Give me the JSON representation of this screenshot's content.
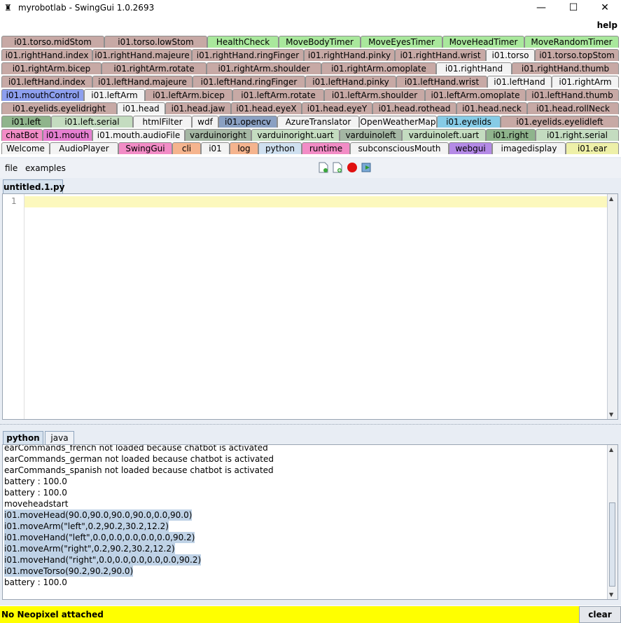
{
  "window": {
    "title": "myrobotlab - SwingGui 1.0.2693",
    "minimize": "—",
    "maximize": "☐",
    "close": "✕"
  },
  "menubar": {
    "help": "help"
  },
  "tab_rows": [
    [
      {
        "label": "i01.torso.midStom",
        "color": "#c7a9a5"
      },
      {
        "label": "i01.torso.lowStom",
        "color": "#c7a9a5"
      },
      {
        "label": "HealthCheck",
        "color": "#a9e89c"
      },
      {
        "label": "MoveBodyTimer",
        "color": "#a9e89c"
      },
      {
        "label": "MoveEyesTimer",
        "color": "#a9e89c"
      },
      {
        "label": "MoveHeadTimer",
        "color": "#a9e89c"
      },
      {
        "label": "MoveRandomTimer",
        "color": "#a9e89c"
      }
    ],
    [
      {
        "label": "i01.rightHand.index",
        "color": "#c7a9a5"
      },
      {
        "label": "i01.rightHand.majeure",
        "color": "#c7a9a5"
      },
      {
        "label": "i01.rightHand.ringFinger",
        "color": "#c7a9a5"
      },
      {
        "label": "i01.rightHand.pinky",
        "color": "#c7a9a5"
      },
      {
        "label": "i01.rightHand.wrist",
        "color": "#c7a9a5"
      },
      {
        "label": "i01.torso",
        "color": "#f3f3f3"
      },
      {
        "label": "i01.torso.topStom",
        "color": "#c7a9a5"
      }
    ],
    [
      {
        "label": "i01.rightArm.bicep",
        "color": "#c7a9a5"
      },
      {
        "label": "i01.rightArm.rotate",
        "color": "#c7a9a5"
      },
      {
        "label": "i01.rightArm.shoulder",
        "color": "#c7a9a5"
      },
      {
        "label": "i01.rightArm.omoplate",
        "color": "#c7a9a5"
      },
      {
        "label": "i01.rightHand",
        "color": "#f3f3f3"
      },
      {
        "label": "i01.rightHand.thumb",
        "color": "#c7a9a5"
      }
    ],
    [
      {
        "label": "i01.leftHand.index",
        "color": "#c7a9a5"
      },
      {
        "label": "i01.leftHand.majeure",
        "color": "#c7a9a5"
      },
      {
        "label": "i01.leftHand.ringFinger",
        "color": "#c7a9a5"
      },
      {
        "label": "i01.leftHand.pinky",
        "color": "#c7a9a5"
      },
      {
        "label": "i01.leftHand.wrist",
        "color": "#c7a9a5"
      },
      {
        "label": "i01.leftHand",
        "color": "#f3f3f3"
      },
      {
        "label": "i01.rightArm",
        "color": "#f3f3f3"
      }
    ],
    [
      {
        "label": "i01.mouthControl",
        "color": "#8d9fee"
      },
      {
        "label": "i01.leftArm",
        "color": "#f3f3f3"
      },
      {
        "label": "i01.leftArm.bicep",
        "color": "#c7a9a5"
      },
      {
        "label": "i01.leftArm.rotate",
        "color": "#c7a9a5"
      },
      {
        "label": "i01.leftArm.shoulder",
        "color": "#c7a9a5"
      },
      {
        "label": "i01.leftArm.omoplate",
        "color": "#c7a9a5"
      },
      {
        "label": "i01.leftHand.thumb",
        "color": "#c7a9a5"
      }
    ],
    [
      {
        "label": "i01.eyelids.eyelidright",
        "color": "#c7a9a5"
      },
      {
        "label": "i01.head",
        "color": "#f3f3f3"
      },
      {
        "label": "i01.head.jaw",
        "color": "#c7a9a5"
      },
      {
        "label": "i01.head.eyeX",
        "color": "#c7a9a5"
      },
      {
        "label": "i01.head.eyeY",
        "color": "#c7a9a5"
      },
      {
        "label": "i01.head.rothead",
        "color": "#c7a9a5"
      },
      {
        "label": "i01.head.neck",
        "color": "#c7a9a5"
      },
      {
        "label": "i01.head.rollNeck",
        "color": "#c7a9a5"
      }
    ],
    [
      {
        "label": "i01.left",
        "color": "#8fb48c"
      },
      {
        "label": "i01.left.serial",
        "color": "#c4dcc0"
      },
      {
        "label": "htmlFilter",
        "color": "#f3f3f3"
      },
      {
        "label": "wdf",
        "color": "#f3f3f3"
      },
      {
        "label": "i01.opencv",
        "color": "#8aa0c2"
      },
      {
        "label": "AzureTranslator",
        "color": "#f3f3f3"
      },
      {
        "label": "OpenWeatherMap",
        "color": "#f3f3f3"
      },
      {
        "label": "i01.eyelids",
        "color": "#86cbe6"
      },
      {
        "label": "i01.eyelids.eyelidleft",
        "color": "#c7a9a5"
      }
    ],
    [
      {
        "label": "chatBot",
        "color": "#f28cc6"
      },
      {
        "label": "i01.mouth",
        "color": "#e57fd1"
      },
      {
        "label": "i01.mouth.audioFile",
        "color": "#f3f3f3"
      },
      {
        "label": "varduinoright",
        "color": "#a5b7a4"
      },
      {
        "label": "varduinoright.uart",
        "color": "#c4dcc0"
      },
      {
        "label": "varduinoleft",
        "color": "#a5b7a4"
      },
      {
        "label": "varduinoleft.uart",
        "color": "#c4dcc0"
      },
      {
        "label": "i01.right",
        "color": "#8fb48c"
      },
      {
        "label": "i01.right.serial",
        "color": "#c4dcc0"
      }
    ],
    [
      {
        "label": "Welcome",
        "color": "#f3f3f3"
      },
      {
        "label": "AudioPlayer",
        "color": "#f3f3f3"
      },
      {
        "label": "SwingGui",
        "color": "#f28cc6"
      },
      {
        "label": "cli",
        "color": "#f5b48e"
      },
      {
        "label": "i01",
        "color": "#f3f3f3"
      },
      {
        "label": "log",
        "color": "#f5b48e"
      },
      {
        "label": "python",
        "color": "#cfe0f0"
      },
      {
        "label": "runtime",
        "color": "#f28cc6"
      },
      {
        "label": "subconsciousMouth",
        "color": "#f3f3f3"
      },
      {
        "label": "webgui",
        "color": "#b48ae6"
      },
      {
        "label": "imagedisplay",
        "color": "#f3f3f3"
      },
      {
        "label": "i01.ear",
        "color": "#eef0a8"
      }
    ]
  ],
  "editor_menu": {
    "file": "file",
    "examples": "examples"
  },
  "toolbar_icons": [
    "new-file-icon",
    "open-file-icon",
    "stop-icon",
    "run-icon"
  ],
  "file_tab": "untitled.1.py",
  "editor": {
    "line_number": "1"
  },
  "bottom_tabs": {
    "python": "python",
    "java": "java"
  },
  "console_lines": [
    {
      "text": "earCommands_french  not loaded because chatbot is activated",
      "selected": false
    },
    {
      "text": "earCommands_german  not loaded because chatbot is activated",
      "selected": false
    },
    {
      "text": "earCommands_spanish  not loaded because chatbot is activated",
      "selected": false
    },
    {
      "text": "battery : 100.0",
      "selected": false
    },
    {
      "text": "battery : 100.0",
      "selected": false
    },
    {
      "text": "moveheadstart",
      "selected": false
    },
    {
      "text": "i01.moveHead(90.0,90.0,90.0,90.0,0.0,90.0)",
      "selected": true
    },
    {
      "text": "i01.moveArm(\"left\",0.2,90.2,30.2,12.2)",
      "selected": true
    },
    {
      "text": "i01.moveHand(\"left\",0.0,0.0,0.0,0.0,0.0,90.2)",
      "selected": true
    },
    {
      "text": "i01.moveArm(\"right\",0.2,90.2,30.2,12.2)",
      "selected": true
    },
    {
      "text": "i01.moveHand(\"right\",0.0,0.0,0.0,0.0,0.0,90.2)",
      "selected": true
    },
    {
      "text": "i01.moveTorso(90.2,90.2,90.0)",
      "selected": true
    },
    {
      "text": "battery : 100.0",
      "selected": false
    }
  ],
  "status": {
    "text": "No Neopixel attached",
    "clear": "clear",
    "color": "#ffff00"
  }
}
